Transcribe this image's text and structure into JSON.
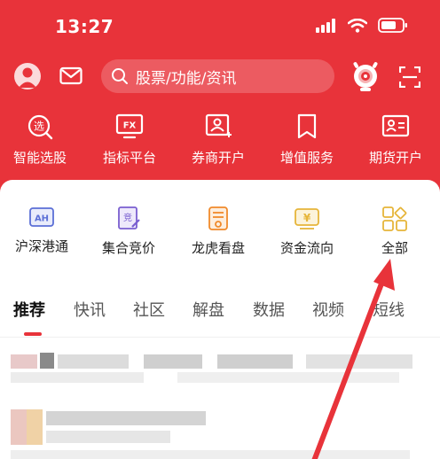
{
  "status_bar": {
    "time": "13:27"
  },
  "header": {
    "search_placeholder": "股票/功能/资讯"
  },
  "top_menu": [
    {
      "label": "智能选股",
      "icon": "smart-stock-pick-icon",
      "glyph": "选"
    },
    {
      "label": "指标平台",
      "icon": "indicator-platform-icon",
      "glyph": "FX"
    },
    {
      "label": "券商开户",
      "icon": "broker-account-icon"
    },
    {
      "label": "增值服务",
      "icon": "value-added-icon"
    },
    {
      "label": "期货开户",
      "icon": "futures-account-icon"
    }
  ],
  "quick_menu": [
    {
      "label": "沪深港通",
      "icon": "stock-connect-icon",
      "glyph": "AH"
    },
    {
      "label": "集合竞价",
      "icon": "call-auction-icon",
      "glyph": "竞"
    },
    {
      "label": "龙虎看盘",
      "icon": "dragon-tiger-icon"
    },
    {
      "label": "资金流向",
      "icon": "fund-flow-icon",
      "glyph": "¥"
    },
    {
      "label": "全部",
      "icon": "all-grid-icon"
    }
  ],
  "tabs": [
    {
      "label": "推荐",
      "active": true
    },
    {
      "label": "快讯"
    },
    {
      "label": "社区"
    },
    {
      "label": "解盘"
    },
    {
      "label": "数据"
    },
    {
      "label": "视频"
    },
    {
      "label": "短线"
    }
  ],
  "colors": {
    "brand_red": "#e8333a",
    "icon_blue": "#5b6fd6",
    "icon_orange": "#f08a2b",
    "icon_gold": "#e6b53a"
  }
}
